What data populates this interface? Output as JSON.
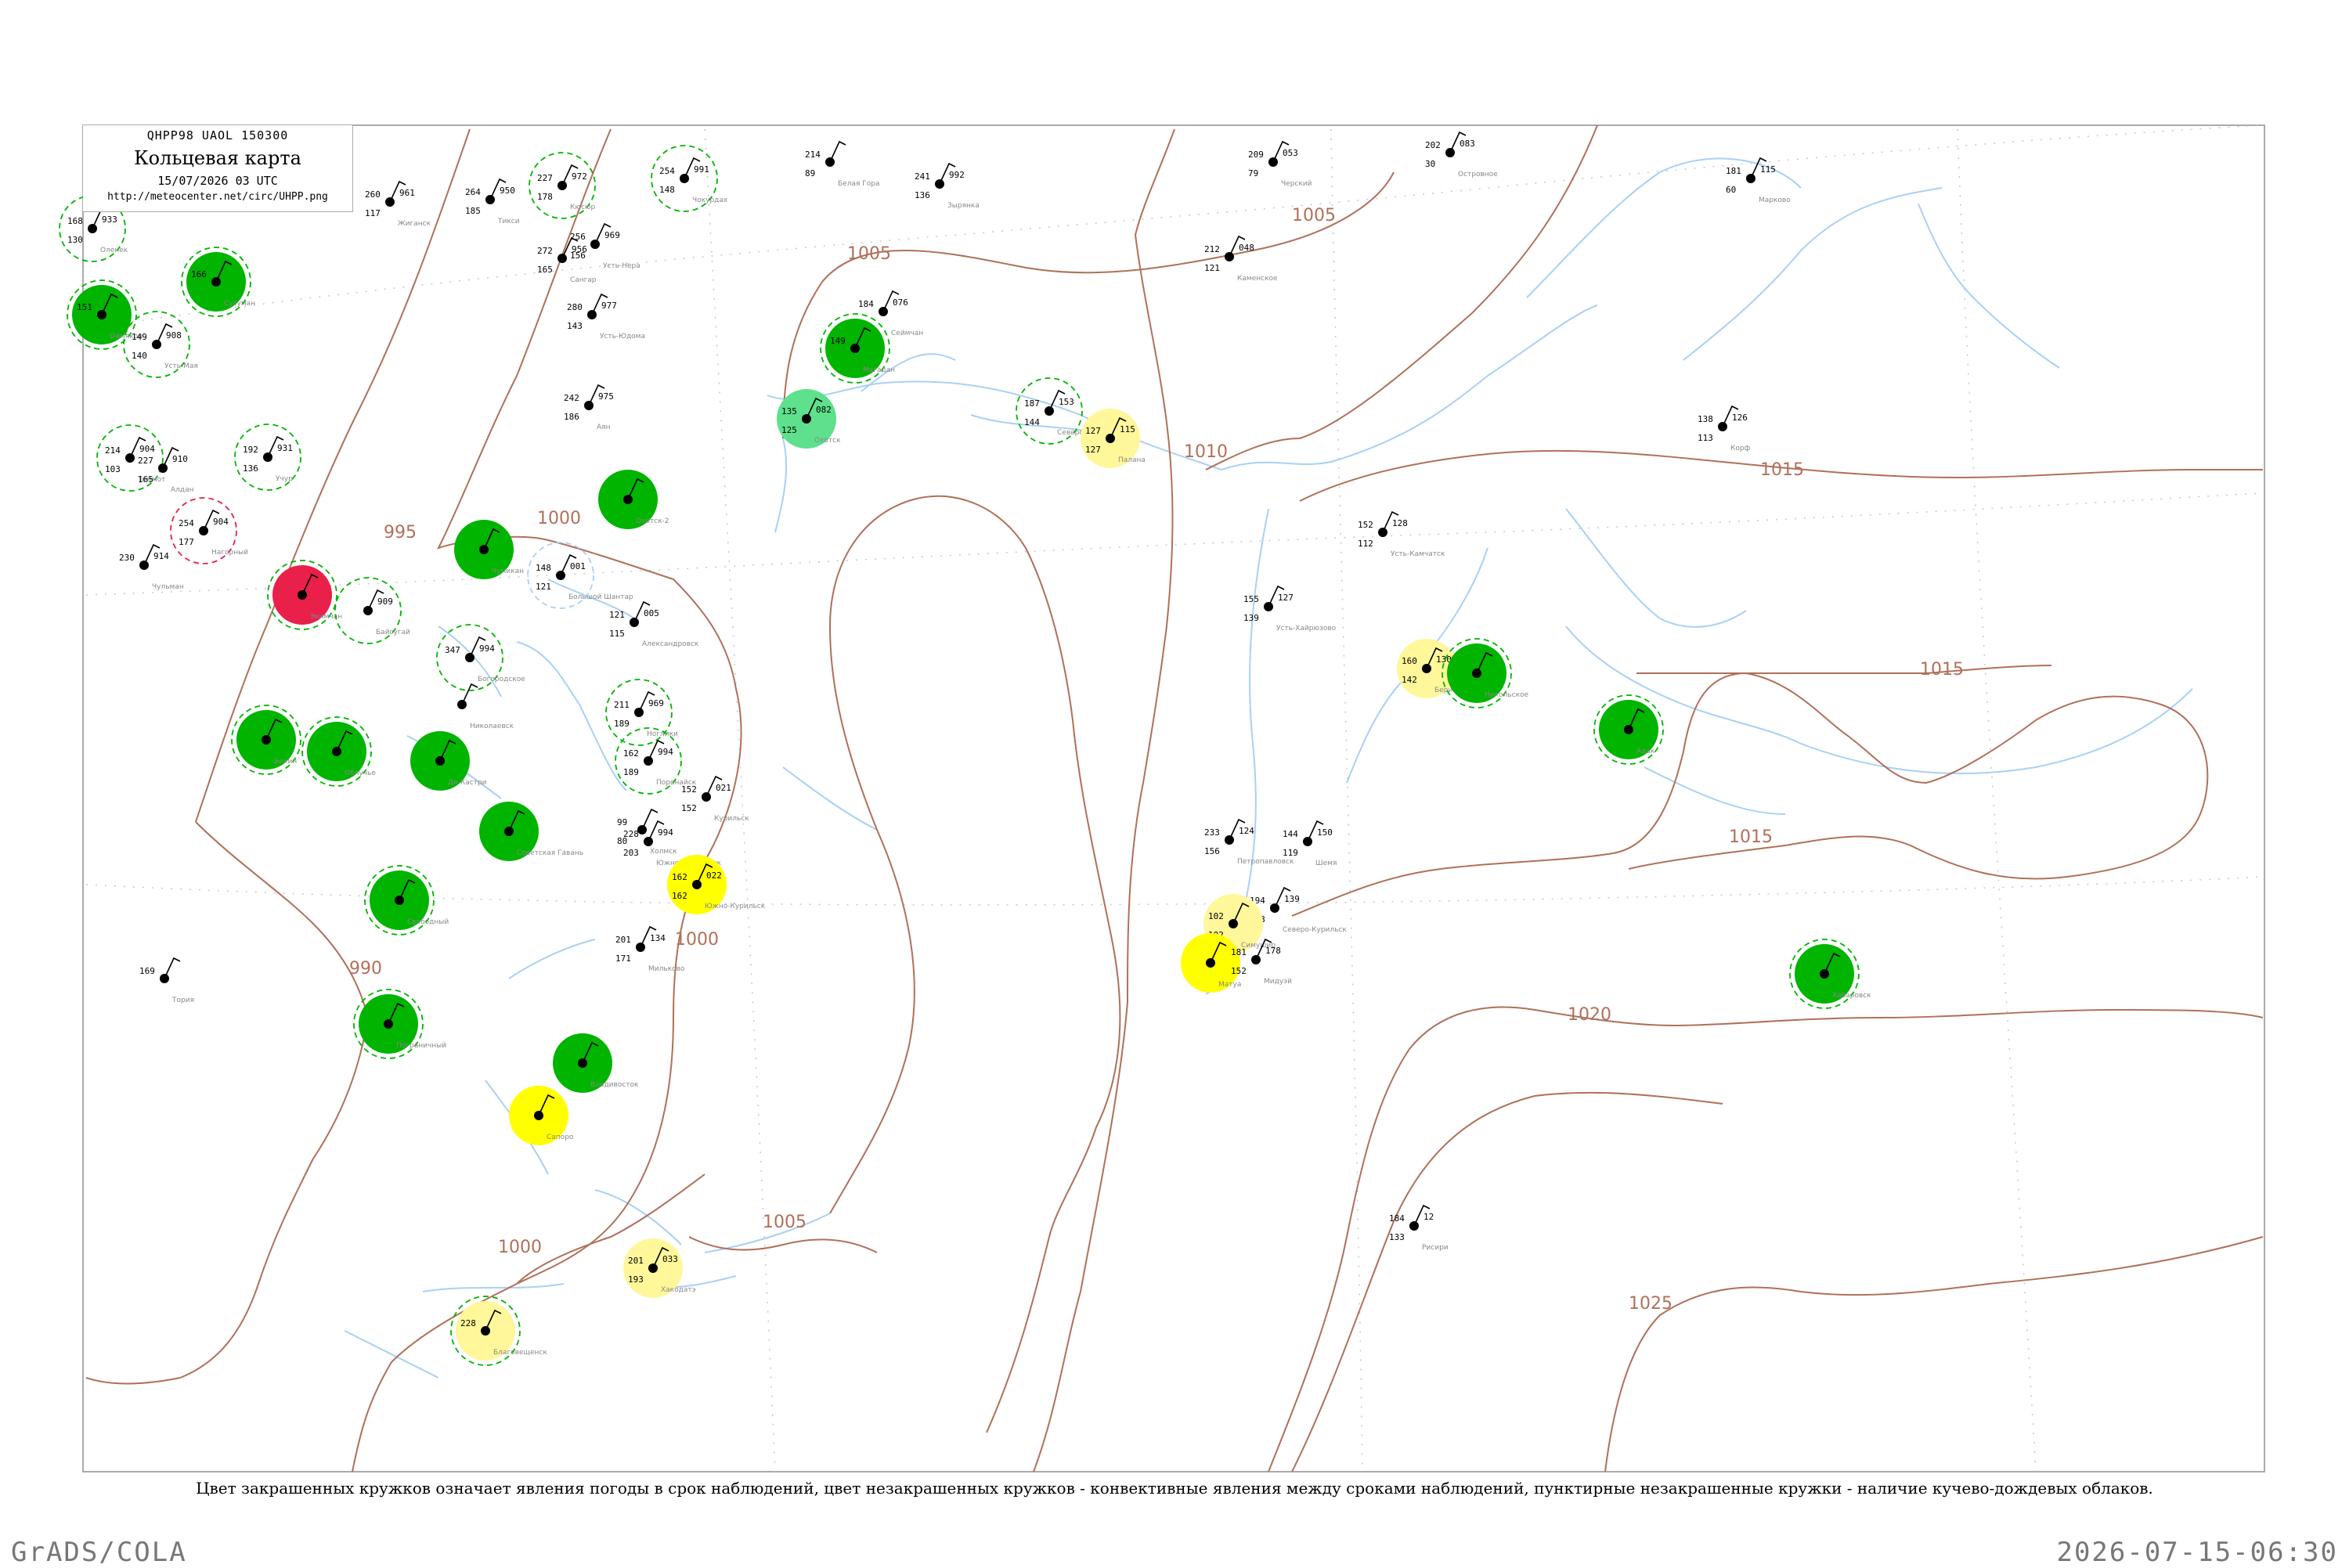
{
  "header": {
    "code_line": "QHPP98  UAOL  150300",
    "title": "Кольцевая карта",
    "datetime": "15/07/2026 03 UTC",
    "url": "http://meteocenter.net/circ/UHPP.png"
  },
  "legend_text": "Цвет закрашенных кружков означает явления погоды в срок наблюдений, цвет незакрашенных кружков - конвективные явления между сроками наблюдений, пунктирные незакрашенные кружки - наличие кучево-дождевых облаков.",
  "footer": {
    "left": "GrADS/COLA",
    "right": "2026-07-15-06:30"
  },
  "colors": {
    "isobar": "#b0705a",
    "coast": "#a9d0f5",
    "green": "#00b400",
    "light_green": "#5ee08c",
    "yellow_light": "#fff79a",
    "yellow": "#ffff00",
    "red": "#e8204a",
    "frame": "#aaaaaa"
  },
  "isobars": [
    "995",
    "1000",
    "1005",
    "1010",
    "1015",
    "1020",
    "1025",
    "990",
    "1000",
    "1005",
    "1015",
    "1015"
  ],
  "stations": [
    {
      "p": "933",
      "t": "168",
      "td": "130",
      "name": "Оленек",
      "fill": "",
      "dashed": "green"
    },
    {
      "p": "961",
      "t": "260",
      "td": "117",
      "name": "Жиганск",
      "fill": "",
      "dashed": ""
    },
    {
      "p": "950",
      "t": "264",
      "td": "185",
      "name": "Тикси",
      "fill": "",
      "dashed": ""
    },
    {
      "p": "972",
      "t": "227",
      "td": "178",
      "name": "Кюсюр",
      "fill": "",
      "dashed": "green"
    },
    {
      "p": "991",
      "t": "254",
      "td": "148",
      "name": "Чокурдах",
      "fill": "",
      "dashed": "green"
    },
    {
      "p": "",
      "t": "214",
      "td": "89",
      "name": "Белая Гора",
      "fill": "",
      "dashed": ""
    },
    {
      "p": "992",
      "t": "241",
      "td": "136",
      "name": "Зырянка",
      "fill": "",
      "dashed": ""
    },
    {
      "p": "053",
      "t": "209",
      "td": "79",
      "name": "Черский",
      "fill": "",
      "dashed": ""
    },
    {
      "p": "083",
      "t": "202",
      "td": "30",
      "name": "Островное",
      "fill": "",
      "dashed": ""
    },
    {
      "p": "115",
      "t": "181",
      "td": "60",
      "name": "Марково",
      "fill": "",
      "dashed": ""
    },
    {
      "p": "",
      "t": "166",
      "td": "",
      "name": "Сусуман",
      "fill": "green",
      "dashed": "green"
    },
    {
      "p": "",
      "t": "151",
      "td": "",
      "name": "Оймякон",
      "fill": "green",
      "dashed": "green"
    },
    {
      "p": "908",
      "t": "149",
      "td": "140",
      "name": "Усть-Мая",
      "fill": "",
      "dashed": "green"
    },
    {
      "p": "956",
      "t": "272",
      "td": "165",
      "name": "Сангар",
      "fill": "",
      "dashed": ""
    },
    {
      "p": "969",
      "t": "256",
      "td": "156",
      "name": "Усть-Нера",
      "fill": "",
      "dashed": ""
    },
    {
      "p": "977",
      "t": "280",
      "td": "143",
      "name": "Усть-Юдома",
      "fill": "",
      "dashed": ""
    },
    {
      "p": "076",
      "t": "184",
      "td": "",
      "name": "Сеймчан",
      "fill": "",
      "dashed": ""
    },
    {
      "p": "",
      "t": "149",
      "td": "",
      "name": "Магадан",
      "fill": "green",
      "dashed": "green"
    },
    {
      "p": "048",
      "t": "212",
      "td": "121",
      "name": "Каменское",
      "fill": "",
      "dashed": ""
    },
    {
      "p": "975",
      "t": "242",
      "td": "186",
      "name": "Аян",
      "fill": "",
      "dashed": ""
    },
    {
      "p": "082",
      "t": "135",
      "td": "125",
      "name": "Охотск",
      "fill": "light_green",
      "dashed": ""
    },
    {
      "p": "153",
      "t": "187",
      "td": "144",
      "name": "Северо-Эвенск",
      "fill": "",
      "dashed": "green"
    },
    {
      "p": "115",
      "t": "127",
      "td": "127",
      "name": "Палана",
      "fill": "yellow_light",
      "dashed": ""
    },
    {
      "p": "126",
      "t": "138",
      "td": "113",
      "name": "Корф",
      "fill": "",
      "dashed": ""
    },
    {
      "p": "904",
      "t": "214",
      "td": "103",
      "name": "Томмот",
      "fill": "",
      "dashed": "green"
    },
    {
      "p": "910",
      "t": "227",
      "td": "165",
      "name": "Алдан",
      "fill": "",
      "dashed": ""
    },
    {
      "p": "931",
      "t": "192",
      "td": "136",
      "name": "Учур",
      "fill": "",
      "dashed": "green"
    },
    {
      "p": "",
      "t": "",
      "td": "",
      "name": "Охотск-2",
      "fill": "green",
      "dashed": ""
    },
    {
      "p": "904",
      "t": "254",
      "td": "177",
      "name": "Нагорный",
      "fill": "",
      "dashed": "red"
    },
    {
      "p": "914",
      "t": "230",
      "td": "",
      "name": "Чульман",
      "fill": "",
      "dashed": ""
    },
    {
      "p": "",
      "t": "",
      "td": "",
      "name": "Экимчан",
      "fill": "red",
      "dashed": "green"
    },
    {
      "p": "909",
      "t": "",
      "td": "",
      "name": "Байсугай",
      "fill": "",
      "dashed": "green"
    },
    {
      "p": "001",
      "t": "148",
      "td": "121",
      "name": "Большой Шантар",
      "fill": "",
      "dashed": "light"
    },
    {
      "p": "",
      "t": "",
      "td": "",
      "name": "Чумикан",
      "fill": "green",
      "dashed": ""
    },
    {
      "p": "128",
      "t": "152",
      "td": "112",
      "name": "Усть-Камчатск",
      "fill": "",
      "dashed": ""
    },
    {
      "p": "127",
      "t": "155",
      "td": "139",
      "name": "Усть-Хайрюзово",
      "fill": "",
      "dashed": ""
    },
    {
      "p": "130",
      "t": "160",
      "td": "142",
      "name": "Беринговский",
      "fill": "yellow_light",
      "dashed": ""
    },
    {
      "p": "",
      "t": "",
      "td": "",
      "name": "Никольское",
      "fill": "green",
      "dashed": "green"
    },
    {
      "p": "",
      "t": "",
      "td": "",
      "name": "Адак",
      "fill": "green",
      "dashed": "green"
    },
    {
      "p": "994",
      "t": "347",
      "td": "",
      "name": "Богородское",
      "fill": "",
      "dashed": "green"
    },
    {
      "p": "",
      "t": "",
      "td": "",
      "name": "Николаевск",
      "fill": "",
      "dashed": ""
    },
    {
      "p": "005",
      "t": "121",
      "td": "115",
      "name": "Александровск",
      "fill": "",
      "dashed": ""
    },
    {
      "p": "969",
      "t": "211",
      "td": "189",
      "name": "Ноглики",
      "fill": "",
      "dashed": "green"
    },
    {
      "p": "994",
      "t": "162",
      "td": "189",
      "name": "Поронайск",
      "fill": "",
      "dashed": "green"
    },
    {
      "p": "021",
      "t": "152",
      "td": "152",
      "name": "Курильск",
      "fill": "",
      "dashed": ""
    },
    {
      "p": "",
      "t": "",
      "td": "",
      "name": "Де-Кастри",
      "fill": "green",
      "dashed": ""
    },
    {
      "p": "",
      "t": "",
      "td": "",
      "name": "Советская Гавань",
      "fill": "green",
      "dashed": ""
    },
    {
      "p": "994",
      "t": "228",
      "td": "203",
      "name": "Южно-Сахалинск",
      "fill": "",
      "dashed": ""
    },
    {
      "p": "",
      "t": "99",
      "td": "80",
      "name": "Холмск",
      "fill": "",
      "dashed": ""
    },
    {
      "p": "022",
      "t": "162",
      "td": "162",
      "name": "Южно-Курильск",
      "fill": "yellow",
      "dashed": ""
    },
    {
      "p": "134",
      "t": "201",
      "td": "171",
      "name": "Мильково",
      "fill": "",
      "dashed": ""
    },
    {
      "p": "124",
      "t": "233",
      "td": "156",
      "name": "Петропавловск",
      "fill": "",
      "dashed": ""
    },
    {
      "p": "150",
      "t": "144",
      "td": "119",
      "name": "Шемя",
      "fill": "",
      "dashed": ""
    },
    {
      "p": "139",
      "t": "194",
      "td": "153",
      "name": "Северо-Курильск",
      "fill": "",
      "dashed": ""
    },
    {
      "p": "",
      "t": "102",
      "td": "102",
      "name": "Симушир",
      "fill": "yellow_light",
      "dashed": ""
    },
    {
      "p": "",
      "t": "",
      "td": "",
      "name": "Матуа",
      "fill": "yellow",
      "dashed": ""
    },
    {
      "p": "178",
      "t": "181",
      "td": "152",
      "name": "Мидуэй",
      "fill": "",
      "dashed": ""
    },
    {
      "p": "",
      "t": "",
      "td": "",
      "name": "Хабаровск",
      "fill": "green",
      "dashed": "green"
    },
    {
      "p": "",
      "t": "",
      "td": "",
      "name": "Бикин",
      "fill": "green",
      "dashed": "green"
    },
    {
      "p": "",
      "t": "",
      "td": "",
      "name": "Облучье",
      "fill": "green",
      "dashed": "green"
    },
    {
      "p": "",
      "t": "",
      "td": "",
      "name": "Свободный",
      "fill": "green",
      "dashed": "green"
    },
    {
      "p": "",
      "t": "",
      "td": "",
      "name": "Пограничный",
      "fill": "green",
      "dashed": "green"
    },
    {
      "p": "",
      "t": "",
      "td": "",
      "name": "Владивосток",
      "fill": "green",
      "dashed": ""
    },
    {
      "p": "",
      "t": "",
      "td": "",
      "name": "Сапоро",
      "fill": "yellow",
      "dashed": ""
    },
    {
      "p": "033",
      "t": "201",
      "td": "193",
      "name": "Хакодатэ",
      "fill": "yellow_light",
      "dashed": ""
    },
    {
      "p": "",
      "t": "228",
      "td": "",
      "name": "Благовещенск",
      "fill": "yellow_light",
      "dashed": "green"
    },
    {
      "p": "",
      "t": "169",
      "td": "",
      "name": "Тория",
      "fill": "",
      "dashed": ""
    },
    {
      "p": "12",
      "t": "184",
      "td": "133",
      "name": "Рисири",
      "fill": "",
      "dashed": ""
    }
  ]
}
